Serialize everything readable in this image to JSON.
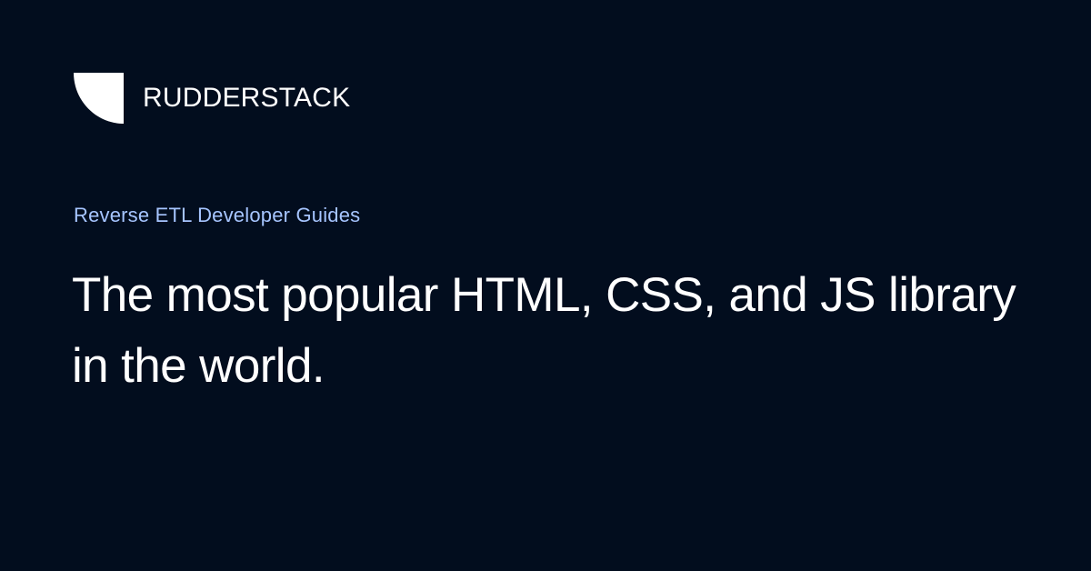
{
  "brand": {
    "name": "RUDDERSTACK",
    "logo_icon": "rudderstack-logo-icon"
  },
  "category": "Reverse ETL Developer Guides",
  "headline": "The most popular HTML, CSS, and JS library in the world.",
  "colors": {
    "background": "#020d1e",
    "text": "#ffffff",
    "accent": "#a6c5ff"
  }
}
